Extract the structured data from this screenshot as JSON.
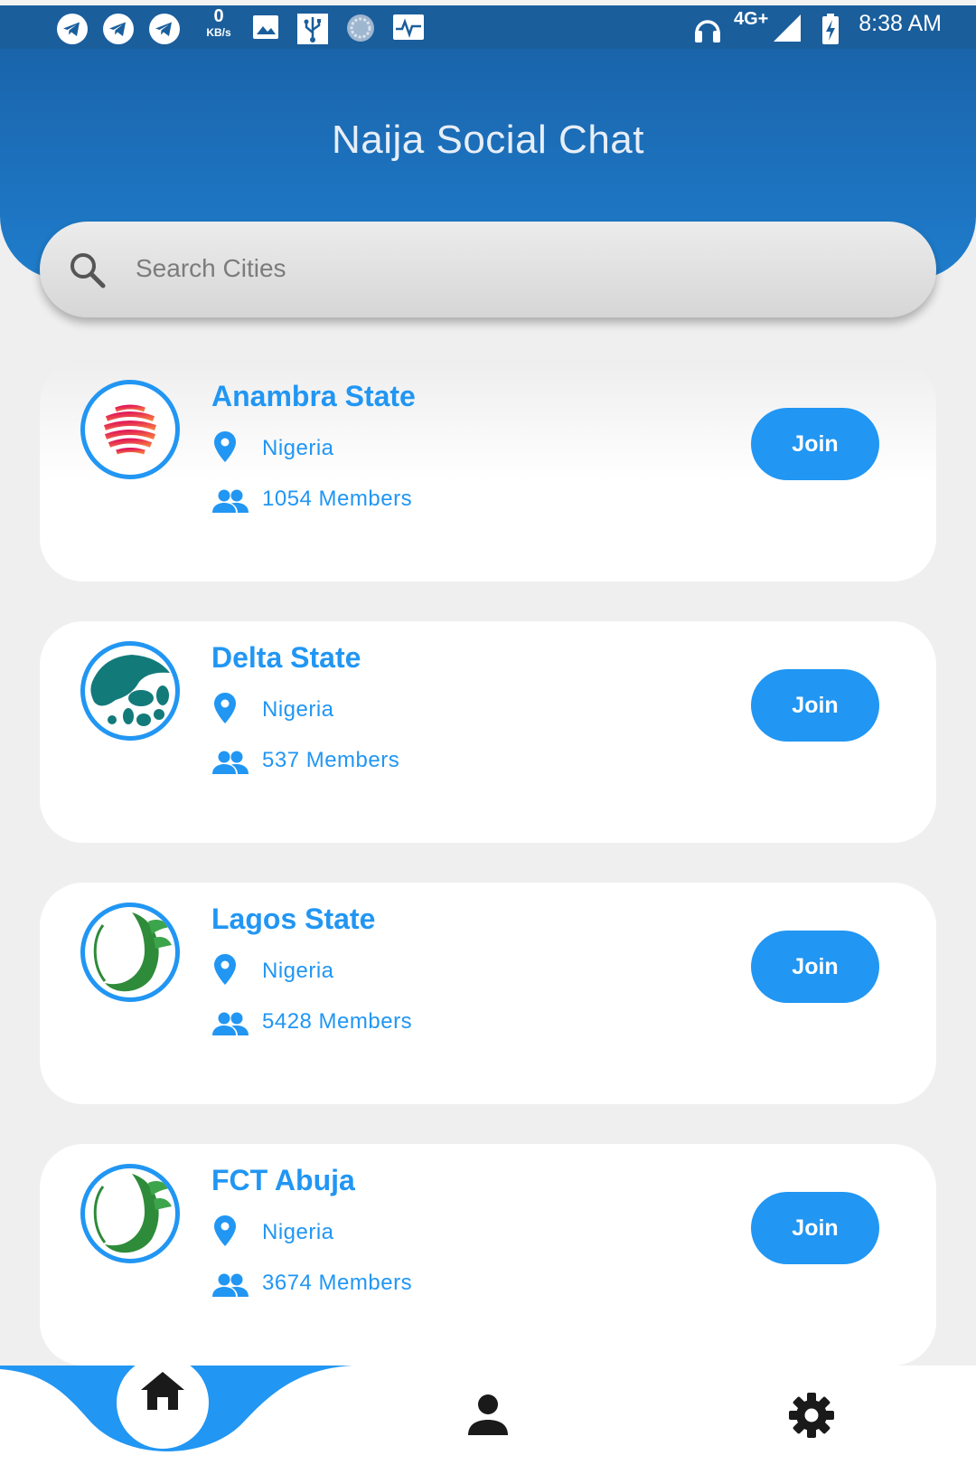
{
  "status_bar": {
    "time": "8:38 AM",
    "net_speed_value": "0",
    "net_speed_unit": "KB/s",
    "network_type": "4G+",
    "icons": [
      "telegram-icon",
      "telegram-icon",
      "telegram-icon",
      "gallery-icon",
      "usb-icon",
      "sync-icon",
      "activity-icon",
      "headphones-icon",
      "signal-icon",
      "battery-charging-icon"
    ]
  },
  "header": {
    "title": "Naija Social Chat"
  },
  "search": {
    "placeholder": "Search Cities",
    "icon": "search-icon"
  },
  "cities": [
    {
      "name": "Anambra State",
      "country": "Nigeria",
      "members": "1054 Members",
      "join_label": "Join",
      "logo": "red-striped-globe"
    },
    {
      "name": "Delta State",
      "country": "Nigeria",
      "members": "537 Members",
      "join_label": "Join",
      "logo": "teal-leaf"
    },
    {
      "name": "Lagos State",
      "country": "Nigeria",
      "members": "5428 Members",
      "join_label": "Join",
      "logo": "green-crescent-leaf"
    },
    {
      "name": "FCT Abuja",
      "country": "Nigeria",
      "members": "3674 Members",
      "join_label": "Join",
      "logo": "green-crescent-leaf"
    }
  ],
  "bottom_nav": {
    "items": [
      "home-icon",
      "profile-icon",
      "settings-icon"
    ],
    "active": "home"
  },
  "colors": {
    "primary": "#2196f3",
    "header": "#1f7dcc",
    "status_bar": "#1a5e9c",
    "background": "#efefef"
  }
}
